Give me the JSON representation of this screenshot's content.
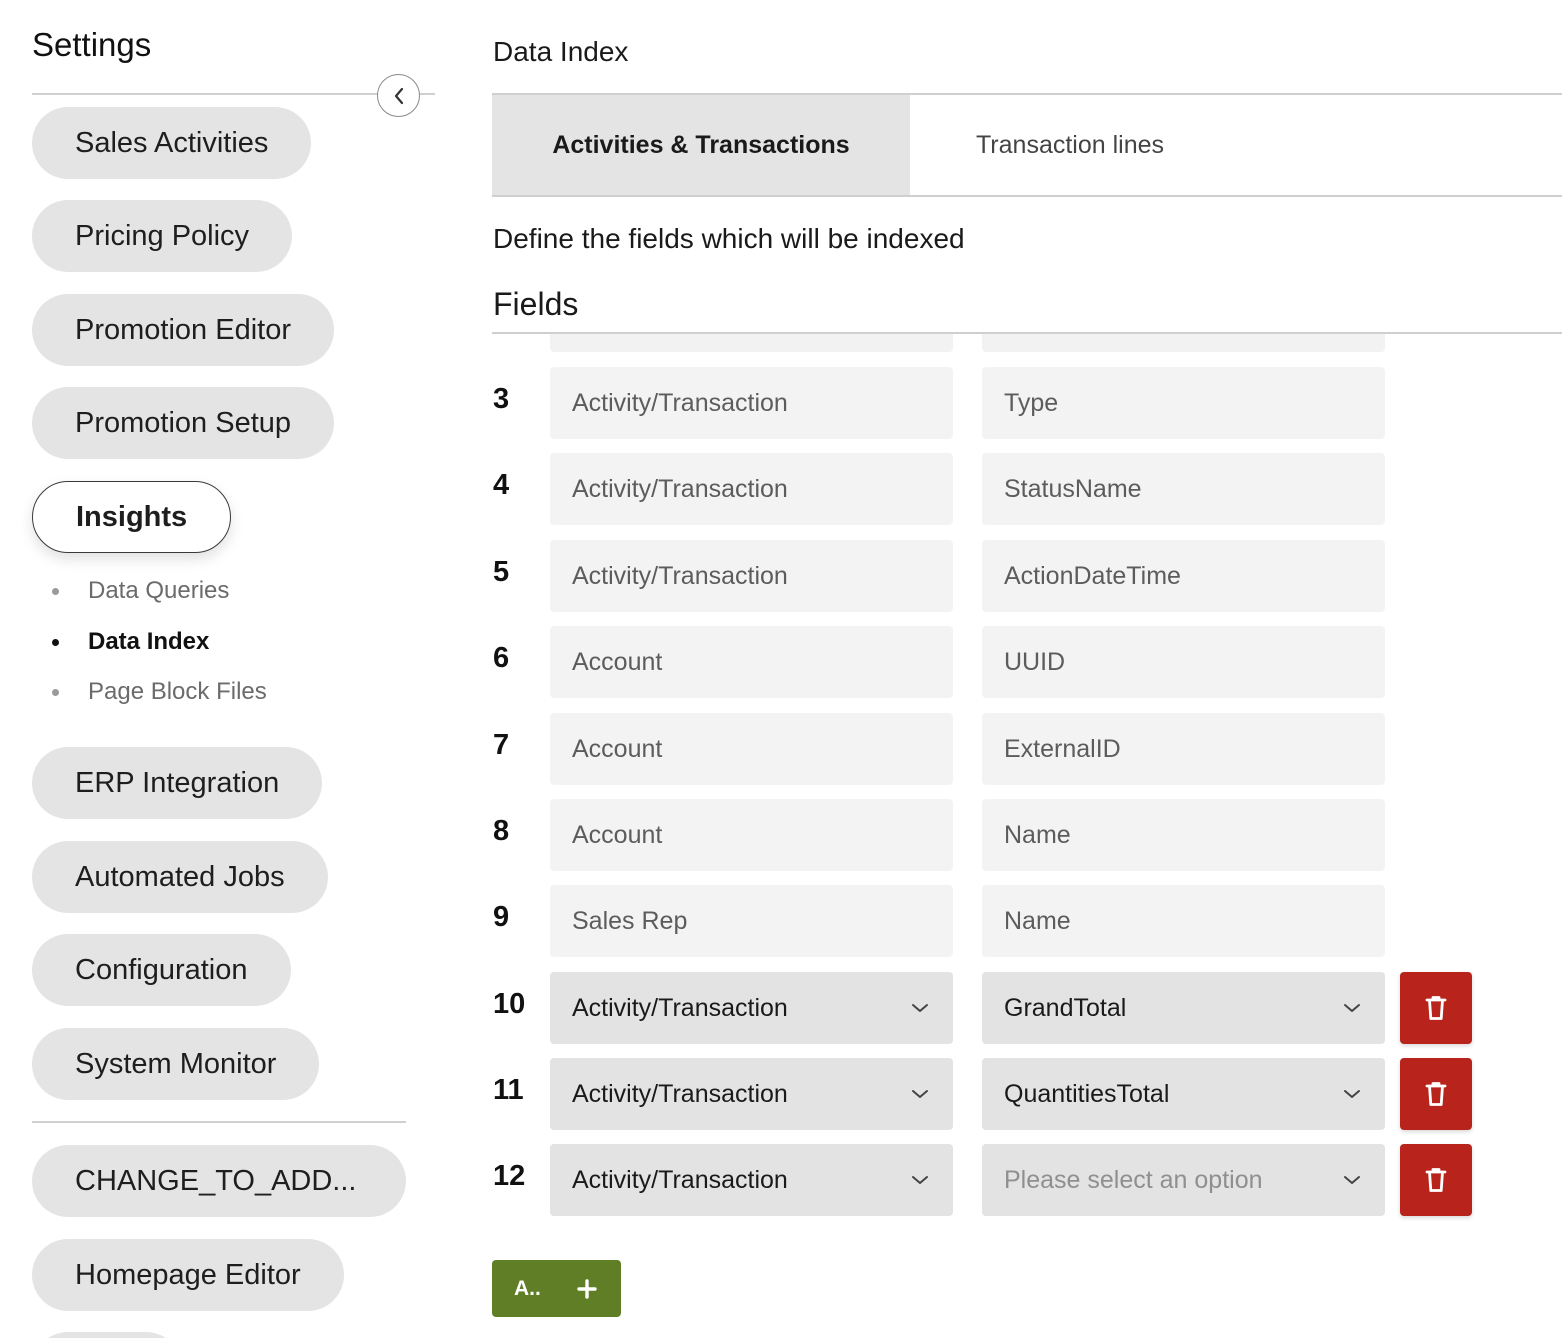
{
  "sidebar": {
    "title": "Settings",
    "collapse_icon": "chevron-left-icon",
    "items": [
      {
        "label": "Sales Activities"
      },
      {
        "label": "Pricing Policy"
      },
      {
        "label": "Promotion Editor"
      },
      {
        "label": "Promotion Setup"
      },
      {
        "label": "Insights",
        "active": true
      },
      {
        "label": "ERP Integration"
      },
      {
        "label": "Automated Jobs"
      },
      {
        "label": "Configuration"
      },
      {
        "label": "System Monitor"
      },
      {
        "label": "CHANGE_TO_ADD..."
      },
      {
        "label": "Homepage Editor"
      }
    ],
    "subitems": [
      {
        "label": "Data Queries"
      },
      {
        "label": "Data Index",
        "active": true
      },
      {
        "label": "Page Block Files"
      }
    ]
  },
  "main": {
    "title": "Data Index",
    "tabs": [
      {
        "label": "Activities & Transactions",
        "active": true
      },
      {
        "label": "Transaction lines"
      }
    ],
    "description": "Define the fields which will be indexed",
    "fields_heading": "Fields",
    "rows": [
      {
        "num": "3",
        "resource": "Activity/Transaction",
        "field": "Type"
      },
      {
        "num": "4",
        "resource": "Activity/Transaction",
        "field": "StatusName"
      },
      {
        "num": "5",
        "resource": "Activity/Transaction",
        "field": "ActionDateTime"
      },
      {
        "num": "6",
        "resource": "Account",
        "field": "UUID"
      },
      {
        "num": "7",
        "resource": "Account",
        "field": "ExternalID"
      },
      {
        "num": "8",
        "resource": "Account",
        "field": "Name"
      },
      {
        "num": "9",
        "resource": "Sales Rep",
        "field": "Name"
      },
      {
        "num": "10",
        "resource": "Activity/Transaction",
        "field": "GrandTotal"
      },
      {
        "num": "11",
        "resource": "Activity/Transaction",
        "field": "QuantitiesTotal"
      },
      {
        "num": "12",
        "resource": "Activity/Transaction",
        "field": "Please select an option"
      }
    ],
    "add_button": {
      "label": "A..",
      "icon": "plus-icon"
    },
    "delete_icon": "trash-icon",
    "colors": {
      "delete": "#b8241c",
      "add": "#5f7e26"
    }
  }
}
